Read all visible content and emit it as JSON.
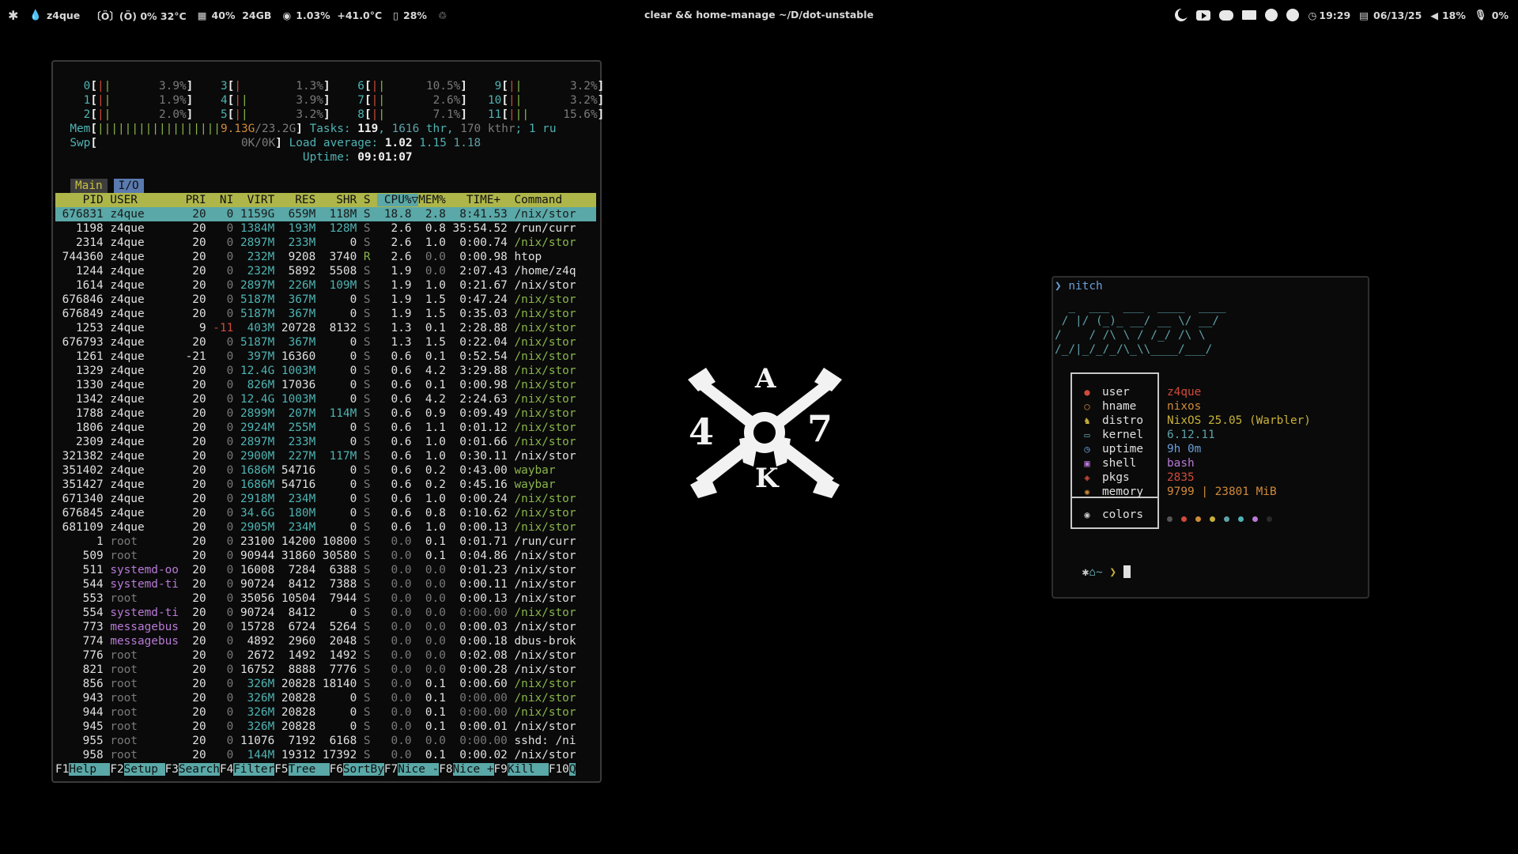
{
  "bar": {
    "left": {
      "workspace": "z4que",
      "fan": "〔Ö〕(Ö) 0% 32°C",
      "ram_pct": "40%",
      "ram_total": "24GB",
      "cpu_pct": "1.03%",
      "cpu_temp": "+41.0°C",
      "disk_pct": "28%"
    },
    "center_title": "clear && home-manage ~/D/dot-unstable",
    "right": {
      "clock": "19:29",
      "date": "06/13/25",
      "volume": "18%",
      "mic": "0%"
    },
    "icons": [
      "nixos-snowflake-icon",
      "drop-icon",
      "fan-icon",
      "ram-icon",
      "cpu-icon",
      "disk-icon",
      "recycle-icon",
      "moon-icon",
      "youtube-icon",
      "discord-icon",
      "mail-icon",
      "reddit-icon",
      "github-icon",
      "clock-icon",
      "calendar-icon",
      "volume-icon",
      "mic-icon"
    ]
  },
  "htop": {
    "cpus": [
      {
        "id": "0",
        "bar": "||",
        "pct": "3.9%"
      },
      {
        "id": "3",
        "bar": "|",
        "pct": "1.3%"
      },
      {
        "id": "6",
        "bar": "||",
        "pct": "10.5%"
      },
      {
        "id": "9",
        "bar": "||",
        "pct": "3.2%"
      },
      {
        "id": "1",
        "bar": "||",
        "pct": "1.9%"
      },
      {
        "id": "4",
        "bar": "||",
        "pct": "3.9%"
      },
      {
        "id": "7",
        "bar": "||",
        "pct": "2.6%"
      },
      {
        "id": "10",
        "bar": "||",
        "pct": "3.2%"
      },
      {
        "id": "2",
        "bar": "||",
        "pct": "2.0%"
      },
      {
        "id": "5",
        "bar": "||",
        "pct": "3.2%"
      },
      {
        "id": "8",
        "bar": "||",
        "pct": "7.1%"
      },
      {
        "id": "11",
        "bar": "|||",
        "pct": "15.6%"
      }
    ],
    "mem_label": "Mem",
    "mem_bar": "||||||||||||||||||",
    "mem_used": "9.13G",
    "mem_total": "/23.2G",
    "swp_label": "Swp",
    "swp_val": "0K/0K",
    "tasks_label": "Tasks: ",
    "tasks": "119",
    "thr": "1616",
    "thr_label": " thr, ",
    "kthr": "170 kthr",
    "run_label": "; 1 ru",
    "load_label": "Load average: ",
    "load1": "1.02",
    "load5": "1.15",
    "load15": "1.18",
    "uptime_label": "Uptime: ",
    "uptime": "09:01:07",
    "tabs": [
      "Main",
      "I/O"
    ],
    "columns": "    PID USER       PRI  NI  VIRT   RES   SHR S  CPU%▽MEM%   TIME+  Command",
    "processes": [
      [
        "676831",
        "z4que",
        "20",
        "0",
        "1159G",
        "659M",
        "118M",
        "S",
        "18.8",
        "2.8",
        "8:41.53",
        "/nix/stor"
      ],
      [
        "1198",
        "z4que",
        "20",
        "0",
        "1384M",
        "193M",
        "128M",
        "S",
        "2.6",
        "0.8",
        "35:54.52",
        "/run/curr"
      ],
      [
        "2314",
        "z4que",
        "20",
        "0",
        "2897M",
        "233M",
        "0",
        "S",
        "2.6",
        "1.0",
        "0:00.74",
        "/nix/stor"
      ],
      [
        "744360",
        "z4que",
        "20",
        "0",
        "232M",
        "9208",
        "3740",
        "R",
        "2.6",
        "0.0",
        "0:00.98",
        "htop"
      ],
      [
        "1244",
        "z4que",
        "20",
        "0",
        "232M",
        "5892",
        "5508",
        "S",
        "1.9",
        "0.0",
        "2:07.43",
        "/home/z4q"
      ],
      [
        "1614",
        "z4que",
        "20",
        "0",
        "2897M",
        "226M",
        "109M",
        "S",
        "1.9",
        "1.0",
        "0:21.67",
        "/nix/stor"
      ],
      [
        "676846",
        "z4que",
        "20",
        "0",
        "5187M",
        "367M",
        "0",
        "S",
        "1.9",
        "1.5",
        "0:47.24",
        "/nix/stor"
      ],
      [
        "676849",
        "z4que",
        "20",
        "0",
        "5187M",
        "367M",
        "0",
        "S",
        "1.9",
        "1.5",
        "0:35.03",
        "/nix/stor"
      ],
      [
        "1253",
        "z4que",
        "9",
        "-11",
        "403M",
        "20728",
        "8132",
        "S",
        "1.3",
        "0.1",
        "2:28.88",
        "/nix/stor"
      ],
      [
        "676793",
        "z4que",
        "20",
        "0",
        "5187M",
        "367M",
        "0",
        "S",
        "1.3",
        "1.5",
        "0:22.04",
        "/nix/stor"
      ],
      [
        "1261",
        "z4que",
        "-21",
        "0",
        "397M",
        "16360",
        "0",
        "S",
        "0.6",
        "0.1",
        "0:52.54",
        "/nix/stor"
      ],
      [
        "1329",
        "z4que",
        "20",
        "0",
        "12.4G",
        "1003M",
        "0",
        "S",
        "0.6",
        "4.2",
        "3:29.88",
        "/nix/stor"
      ],
      [
        "1330",
        "z4que",
        "20",
        "0",
        "826M",
        "17036",
        "0",
        "S",
        "0.6",
        "0.1",
        "0:00.98",
        "/nix/stor"
      ],
      [
        "1342",
        "z4que",
        "20",
        "0",
        "12.4G",
        "1003M",
        "0",
        "S",
        "0.6",
        "4.2",
        "2:24.63",
        "/nix/stor"
      ],
      [
        "1788",
        "z4que",
        "20",
        "0",
        "2899M",
        "207M",
        "114M",
        "S",
        "0.6",
        "0.9",
        "0:09.49",
        "/nix/stor"
      ],
      [
        "1806",
        "z4que",
        "20",
        "0",
        "2924M",
        "255M",
        "0",
        "S",
        "0.6",
        "1.1",
        "0:01.12",
        "/nix/stor"
      ],
      [
        "2309",
        "z4que",
        "20",
        "0",
        "2897M",
        "233M",
        "0",
        "S",
        "0.6",
        "1.0",
        "0:01.66",
        "/nix/stor"
      ],
      [
        "321382",
        "z4que",
        "20",
        "0",
        "2900M",
        "227M",
        "117M",
        "S",
        "0.6",
        "1.0",
        "0:30.11",
        "/nix/stor"
      ],
      [
        "351402",
        "z4que",
        "20",
        "0",
        "1686M",
        "54716",
        "0",
        "S",
        "0.6",
        "0.2",
        "0:43.00",
        "waybar"
      ],
      [
        "351427",
        "z4que",
        "20",
        "0",
        "1686M",
        "54716",
        "0",
        "S",
        "0.6",
        "0.2",
        "0:45.16",
        "waybar"
      ],
      [
        "671340",
        "z4que",
        "20",
        "0",
        "2918M",
        "234M",
        "0",
        "S",
        "0.6",
        "1.0",
        "0:00.24",
        "/nix/stor"
      ],
      [
        "676845",
        "z4que",
        "20",
        "0",
        "34.6G",
        "180M",
        "0",
        "S",
        "0.6",
        "0.8",
        "0:10.62",
        "/nix/stor"
      ],
      [
        "681109",
        "z4que",
        "20",
        "0",
        "2905M",
        "234M",
        "0",
        "S",
        "0.6",
        "1.0",
        "0:00.13",
        "/nix/stor"
      ],
      [
        "1",
        "root",
        "20",
        "0",
        "23100",
        "14200",
        "10800",
        "S",
        "0.0",
        "0.1",
        "0:01.71",
        "/run/curr"
      ],
      [
        "509",
        "root",
        "20",
        "0",
        "90944",
        "31860",
        "30580",
        "S",
        "0.0",
        "0.1",
        "0:04.86",
        "/nix/stor"
      ],
      [
        "511",
        "systemd-oo",
        "20",
        "0",
        "16008",
        "7284",
        "6388",
        "S",
        "0.0",
        "0.0",
        "0:01.23",
        "/nix/stor"
      ],
      [
        "544",
        "systemd-ti",
        "20",
        "0",
        "90724",
        "8412",
        "7388",
        "S",
        "0.0",
        "0.0",
        "0:00.11",
        "/nix/stor"
      ],
      [
        "553",
        "root",
        "20",
        "0",
        "35056",
        "10504",
        "7944",
        "S",
        "0.0",
        "0.0",
        "0:00.13",
        "/nix/stor"
      ],
      [
        "554",
        "systemd-ti",
        "20",
        "0",
        "90724",
        "8412",
        "0",
        "S",
        "0.0",
        "0.0",
        "0:00.00",
        "/nix/stor"
      ],
      [
        "773",
        "messagebus",
        "20",
        "0",
        "15728",
        "6724",
        "5264",
        "S",
        "0.0",
        "0.0",
        "0:00.03",
        "/nix/stor"
      ],
      [
        "774",
        "messagebus",
        "20",
        "0",
        "4892",
        "2960",
        "2048",
        "S",
        "0.0",
        "0.0",
        "0:00.18",
        "dbus-brok"
      ],
      [
        "776",
        "root",
        "20",
        "0",
        "2672",
        "1492",
        "1492",
        "S",
        "0.0",
        "0.0",
        "0:02.08",
        "/nix/stor"
      ],
      [
        "821",
        "root",
        "20",
        "0",
        "16752",
        "8888",
        "7776",
        "S",
        "0.0",
        "0.0",
        "0:00.28",
        "/nix/stor"
      ],
      [
        "856",
        "root",
        "20",
        "0",
        "326M",
        "20828",
        "18140",
        "S",
        "0.0",
        "0.1",
        "0:00.60",
        "/nix/stor"
      ],
      [
        "943",
        "root",
        "20",
        "0",
        "326M",
        "20828",
        "0",
        "S",
        "0.0",
        "0.1",
        "0:00.00",
        "/nix/stor"
      ],
      [
        "944",
        "root",
        "20",
        "0",
        "326M",
        "20828",
        "0",
        "S",
        "0.0",
        "0.1",
        "0:00.00",
        "/nix/stor"
      ],
      [
        "945",
        "root",
        "20",
        "0",
        "326M",
        "20828",
        "0",
        "S",
        "0.0",
        "0.1",
        "0:00.01",
        "/nix/stor"
      ],
      [
        "955",
        "root",
        "20",
        "0",
        "11076",
        "7192",
        "6168",
        "S",
        "0.0",
        "0.0",
        "0:00.00",
        "sshd: /ni"
      ],
      [
        "958",
        "root",
        "20",
        "0",
        "144M",
        "19312",
        "17392",
        "S",
        "0.0",
        "0.1",
        "0:00.02",
        "/nix/stor"
      ]
    ],
    "fkeys": [
      {
        "key": "F1",
        "label": "Help  "
      },
      {
        "key": "F2",
        "label": "Setup "
      },
      {
        "key": "F3",
        "label": "Search"
      },
      {
        "key": "F4",
        "label": "Filter"
      },
      {
        "key": "F5",
        "label": "Tree  "
      },
      {
        "key": "F6",
        "label": "SortBy"
      },
      {
        "key": "F7",
        "label": "Nice -"
      },
      {
        "key": "F8",
        "label": "Nice +"
      },
      {
        "key": "F9",
        "label": "Kill  "
      },
      {
        "key": "F10",
        "label": "Q"
      }
    ]
  },
  "logo": {
    "letters": [
      "A",
      "4",
      "7",
      "K"
    ]
  },
  "nitch": {
    "prompt": "❯ nitch",
    "ascii": [
      "  _  ___  ___  ____  ____",
      " / |/ (_)_ __/ __ \\/ __/",
      "/    / /\\ \\ / /_/ /\\ \\  ",
      "/_/|_/_/_/\\_\\\\____/___/  "
    ],
    "info": [
      {
        "icon": "user-icon",
        "label": "user",
        "value": "z4que",
        "color": "#d14a3a"
      },
      {
        "icon": "hostname-icon",
        "label": "hname",
        "value": "nixos",
        "color": "#d08a3a"
      },
      {
        "icon": "penguin-icon",
        "label": "distro",
        "value": "NixOS 25.05 (Warbler)",
        "color": "#c8b13a"
      },
      {
        "icon": "laptop-icon",
        "label": "kernel",
        "value": "6.12.11",
        "color": "#5ea1a8"
      },
      {
        "icon": "clock-icon",
        "label": "uptime",
        "value": "9h 0m",
        "color": "#6a9fd8"
      },
      {
        "icon": "terminal-icon",
        "label": "shell",
        "value": "bash",
        "color": "#b87ad6"
      },
      {
        "icon": "package-icon",
        "label": "pkgs",
        "value": "2835",
        "color": "#d14a3a"
      },
      {
        "icon": "chip-icon",
        "label": "memory",
        "value": "9799 | 23801 MiB",
        "color": "#d08a3a"
      }
    ],
    "colors_label": "colors",
    "color_dots": [
      "#555555",
      "#d14a3a",
      "#d08a3a",
      "#c8b13a",
      "#5ea1a8",
      "#4fb3b3",
      "#b87ad6",
      "#2a2a2a"
    ],
    "cwd": "~"
  }
}
